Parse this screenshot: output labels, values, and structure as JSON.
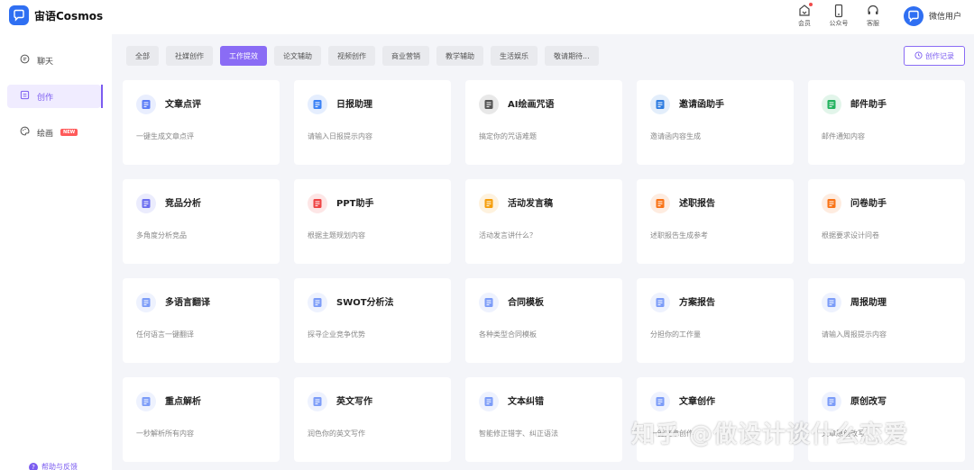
{
  "app": {
    "name": "宙语Cosmos"
  },
  "topbar": {
    "items": [
      {
        "icon": "vip-icon",
        "label": "会员",
        "has_dot": true
      },
      {
        "icon": "phone-icon",
        "label": "公众号"
      },
      {
        "icon": "headset-icon",
        "label": "客服"
      }
    ],
    "user_name": "微信用户"
  },
  "sidebar": {
    "items": [
      {
        "icon": "chat-icon",
        "label": "聊天"
      },
      {
        "icon": "create-icon",
        "label": "创作",
        "active": true
      },
      {
        "icon": "palette-icon",
        "label": "绘画",
        "badge": "NEW"
      }
    ],
    "help_label": "帮助与反馈"
  },
  "tabs": [
    "全部",
    "社媒创作",
    "工作提效",
    "论文辅助",
    "视频创作",
    "商业营销",
    "教学辅助",
    "生活娱乐",
    "敬请期待..."
  ],
  "active_tab": "工作提效",
  "history_button": "创作记录",
  "cards": [
    {
      "title": "文章点评",
      "desc": "一键生成文章点评",
      "icon": "doc-review-icon",
      "color": "#5b7cf7"
    },
    {
      "title": "日报助理",
      "desc": "请输入日报提示内容",
      "icon": "daily-report-icon",
      "color": "#3b82f6"
    },
    {
      "title": "AI绘画咒语",
      "desc": "搞定你的咒语难题",
      "icon": "sailboat-icon",
      "color": "#555555"
    },
    {
      "title": "邀请函助手",
      "desc": "邀请函内容生成",
      "icon": "envelope-open-icon",
      "color": "#2f7de1"
    },
    {
      "title": "邮件助手",
      "desc": "邮件通知内容",
      "icon": "mail-icon",
      "color": "#22b35e"
    },
    {
      "title": "竞品分析",
      "desc": "多角度分析竞品",
      "icon": "bar-chart-icon",
      "color": "#6b6ef0"
    },
    {
      "title": "PPT助手",
      "desc": "根据主题规划内容",
      "icon": "presentation-icon",
      "color": "#ef4444"
    },
    {
      "title": "活动发言稿",
      "desc": "活动发言讲什么？",
      "icon": "speech-bubble-icon",
      "color": "#f59e0b"
    },
    {
      "title": "述职报告",
      "desc": "述职报告生成参考",
      "icon": "report-star-icon",
      "color": "#f97316"
    },
    {
      "title": "问卷助手",
      "desc": "根据要求设计问卷",
      "icon": "questionnaire-icon",
      "color": "#f97316"
    },
    {
      "title": "多语言翻译",
      "desc": "任何语言一键翻译",
      "icon": "translate-icon",
      "color": "#7c9cf8"
    },
    {
      "title": "SWOT分析法",
      "desc": "探寻企业竞争优势",
      "icon": "team-icon",
      "color": "#7c9cf8"
    },
    {
      "title": "合同模板",
      "desc": "各种类型合同模板",
      "icon": "contract-icon",
      "color": "#7c9cf8"
    },
    {
      "title": "方案报告",
      "desc": "分担你的工作量",
      "icon": "plan-report-icon",
      "color": "#7c9cf8"
    },
    {
      "title": "周报助理",
      "desc": "请输入周报提示内容",
      "icon": "weekly-report-icon",
      "color": "#7c9cf8"
    },
    {
      "title": "重点解析",
      "desc": "一秒解析所有内容",
      "icon": "globe-stand-icon",
      "color": "#7c9cf8"
    },
    {
      "title": "英文写作",
      "desc": "润色你的英文写作",
      "icon": "pen-icon",
      "color": "#7c9cf8"
    },
    {
      "title": "文本纠错",
      "desc": "智能修正错字、纠正语法",
      "icon": "text-check-icon",
      "color": "#7c9cf8"
    },
    {
      "title": "文章创作",
      "desc": "一键文章创作",
      "icon": "article-write-icon",
      "color": "#7c9cf8"
    },
    {
      "title": "原创改写",
      "desc": "文章原创改写",
      "icon": "rewrite-icon",
      "color": "#7c9cf8"
    }
  ],
  "watermark": "知乎 @做设计谈什么恋爱"
}
